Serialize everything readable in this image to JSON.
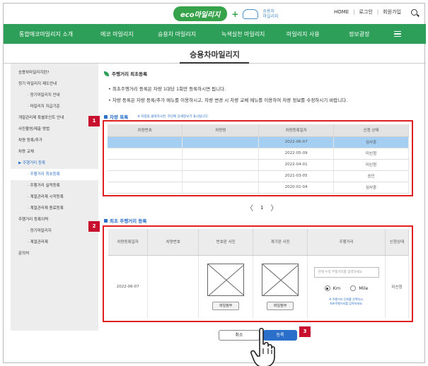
{
  "header": {
    "logo_text": "eco마일리지",
    "logo_plus": "+",
    "logo_sub": "승용차\n마일리지",
    "util_links": [
      "HOME",
      "로그인",
      "회원가입"
    ]
  },
  "nav": {
    "items": [
      "통합에코마일리지 소개",
      "에코 마일리지",
      "승용차 마일리지",
      "녹색실천 마일리지",
      "마일리지 사용",
      "정보광장"
    ]
  },
  "page": {
    "title": "승용차마일리지"
  },
  "sidebar": {
    "items": [
      {
        "label": "승용차마일리지란?",
        "type": "main"
      },
      {
        "label": "정기 마일리지 제도안내",
        "type": "main"
      },
      {
        "label": "· 정기마일리지 안내",
        "type": "sub"
      },
      {
        "label": "· 마일리지 지급기준",
        "type": "sub"
      },
      {
        "label": "개절관리제 특별포인트 안내",
        "type": "main"
      },
      {
        "label": "사진촬영/제출 방법",
        "type": "main"
      },
      {
        "label": "차량 등록/추가",
        "type": "main"
      },
      {
        "label": "차량 교체",
        "type": "main"
      },
      {
        "label": "▶ 주행거리 등록",
        "type": "active"
      },
      {
        "label": "· 주행거리 최초등록",
        "type": "active-sub"
      },
      {
        "label": "· 주행거리 실적등록",
        "type": "sub"
      },
      {
        "label": "· 계절관리제 시작등록",
        "type": "sub"
      },
      {
        "label": "· 계절관리제 종료등록",
        "type": "sub"
      },
      {
        "label": "주행거리 등록이력",
        "type": "main"
      },
      {
        "label": "· 정기마일리지",
        "type": "sub"
      },
      {
        "label": "· 계절관리제",
        "type": "sub"
      },
      {
        "label": "문의처",
        "type": "main"
      }
    ]
  },
  "content": {
    "section_heading": "주행거리 최초등록",
    "notices": [
      "• 최초주행거리 등록은 차량 1대당 1회만 등록하시면 됩니다.",
      "• 차량 등록은 차량 등록/추가 메뉴를 이용하시고, 차량 변경 시 차량 교체 메뉴를 이용하여 차량 정보를 수정하시기 바랍니다."
    ]
  },
  "vehicle_list": {
    "heading": "차량 목록",
    "hint": "※ 차량을 클릭하시면, 하단에 상세정보가 표시됩니다.",
    "badge": "1",
    "columns": [
      "차량번호",
      "차량명",
      "차량등록일자",
      "신청 상태"
    ],
    "rows": [
      {
        "plate": "",
        "name": "",
        "date": "2022-06-07",
        "status": "심사중",
        "selected": true
      },
      {
        "plate": "",
        "name": "",
        "date": "2022-05-09",
        "status": "미신청",
        "selected": false
      },
      {
        "plate": "",
        "name": "",
        "date": "2022-04-01",
        "status": "미신청",
        "selected": false
      },
      {
        "plate": "",
        "name": "",
        "date": "2021-03-05",
        "status": "승인",
        "selected": false
      },
      {
        "plate": "",
        "name": "",
        "date": "2020-01-04",
        "status": "심사중",
        "selected": false
      }
    ],
    "pagination": {
      "prev": "〈",
      "page": "1",
      "next": "〉"
    }
  },
  "initial_mileage": {
    "heading": "최초 주행거리 등록",
    "badge": "2",
    "columns": [
      "차량등록일자",
      "차량번호",
      "번호판 사진",
      "계기판 사진",
      "주행거리",
      "신청상태"
    ],
    "row": {
      "date": "2022-06-07",
      "plate": "",
      "attach_label": "파일첨부",
      "mileage_placeholder": "현재 누적 주행거리를 입력하세요",
      "unit_km": "Km",
      "unit_mile": "Mile",
      "selected_unit": "km",
      "mileage_note": "※ 주행거리 단위를 선택하고,\n최초주행거리를 입력하세요.",
      "status": "미신청"
    }
  },
  "actions": {
    "cancel_label": "취소",
    "register_label": "등록",
    "badge": "3"
  }
}
